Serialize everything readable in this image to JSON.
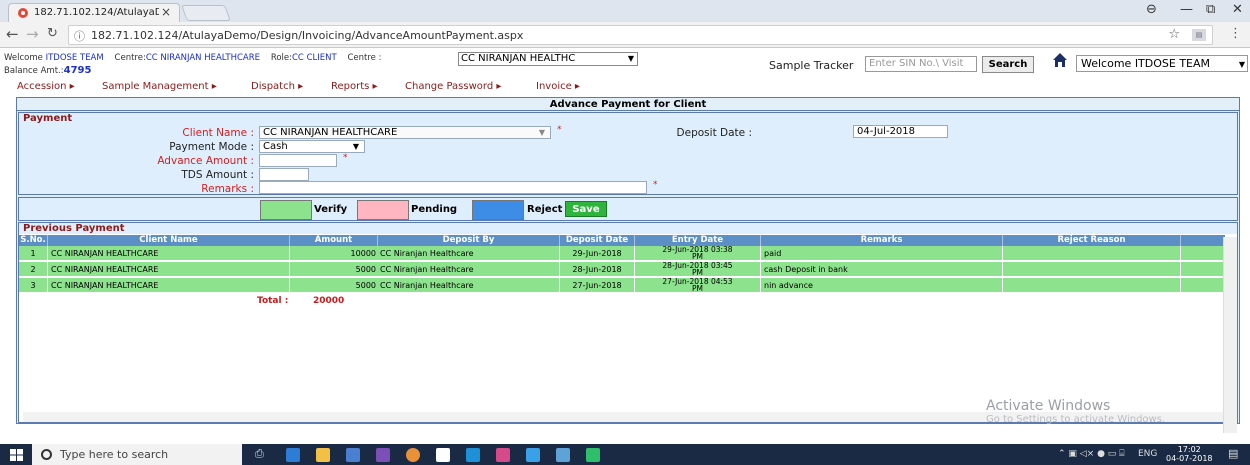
{
  "browser": {
    "tab_title": "182.71.102.124/AtulayaD",
    "tab_close": "×",
    "url": "182.71.102.124/AtulayaDemo/Design/Invoicing/AdvanceAmountPayment.aspx",
    "star": "☆"
  },
  "header": {
    "welcome_prefix": "Welcome ",
    "welcome_name": "ITDOSE TEAM",
    "centre_prefix": "Centre:",
    "centre_name": "CC NIRANJAN HEALTHCARE",
    "role_prefix": "Role:",
    "role_name": "CC CLIENT",
    "centre_select_label": "Centre :",
    "centre_select_value": "CC NIRANJAN HEALTHC",
    "balance_label": "Balance Amt.:",
    "balance_value": "4795",
    "sample_tracker_label": "Sample Tracker",
    "sample_tracker_placeholder": "Enter SIN No.\\ Visit",
    "search_label": "Search",
    "user_select_value": "Welcome ITDOSE TEAM"
  },
  "menu": {
    "items": [
      "Accession ▸",
      "Sample Management ▸",
      "Dispatch ▸",
      "Reports ▸",
      "Change Password ▸",
      "Invoice ▸"
    ]
  },
  "panel": {
    "title": "Advance Payment for Client"
  },
  "payment": {
    "section_title": "Payment",
    "client_name_label": "Client Name :",
    "client_name_value": "CC NIRANJAN HEALTHCARE",
    "deposit_date_label": "Deposit Date :",
    "deposit_date_value": "04-Jul-2018",
    "payment_mode_label": "Payment Mode :",
    "payment_mode_value": "Cash",
    "advance_amount_label": "Advance Amount :",
    "advance_amount_value": "",
    "tds_amount_label": "TDS Amount :",
    "tds_amount_value": "",
    "remarks_label": "Remarks :",
    "remarks_value": "",
    "required_mark": "*"
  },
  "legend": {
    "verify_label": "Verify",
    "pending_label": "Pending",
    "reject_label": "Reject",
    "save_label": "Save",
    "colors": {
      "verify": "#8de28d",
      "pending": "#ffb6c1",
      "reject": "#3d8ce6"
    }
  },
  "previous": {
    "section_title": "Previous Payment",
    "columns": [
      "S.No.",
      "Client Name",
      "Amount",
      "Deposit By",
      "Deposit Date",
      "Entry Date",
      "Remarks",
      "Reject Reason"
    ],
    "rows": [
      {
        "sno": "1",
        "client": "CC NIRANJAN HEALTHCARE",
        "amount": "10000",
        "deposit_by": "CC Niranjan Healthcare",
        "deposit_date": "29-Jun-2018",
        "entry_date_1": "29-Jun-2018 03:38",
        "entry_date_2": "PM",
        "remarks": "paid",
        "reject_reason": ""
      },
      {
        "sno": "2",
        "client": "CC NIRANJAN HEALTHCARE",
        "amount": "5000",
        "deposit_by": "CC Niranjan Healthcare",
        "deposit_date": "28-Jun-2018",
        "entry_date_1": "28-Jun-2018 03:45",
        "entry_date_2": "PM",
        "remarks": "cash Deposit in bank",
        "reject_reason": ""
      },
      {
        "sno": "3",
        "client": "CC NIRANJAN HEALTHCARE",
        "amount": "5000",
        "deposit_by": "CC Niranjan Healthcare",
        "deposit_date": "27-Jun-2018",
        "entry_date_1": "27-Jun-2018 04:53",
        "entry_date_2": "PM",
        "remarks": "nin advance",
        "reject_reason": ""
      }
    ],
    "total_label": "Total :",
    "total_value": "20000"
  },
  "watermark": {
    "line1": "Activate Windows",
    "line2": "Go to Settings to activate Windows."
  },
  "taskbar": {
    "search_placeholder": "Type here to search",
    "lang": "ENG",
    "time": "17:02",
    "date": "04-07-2018"
  }
}
